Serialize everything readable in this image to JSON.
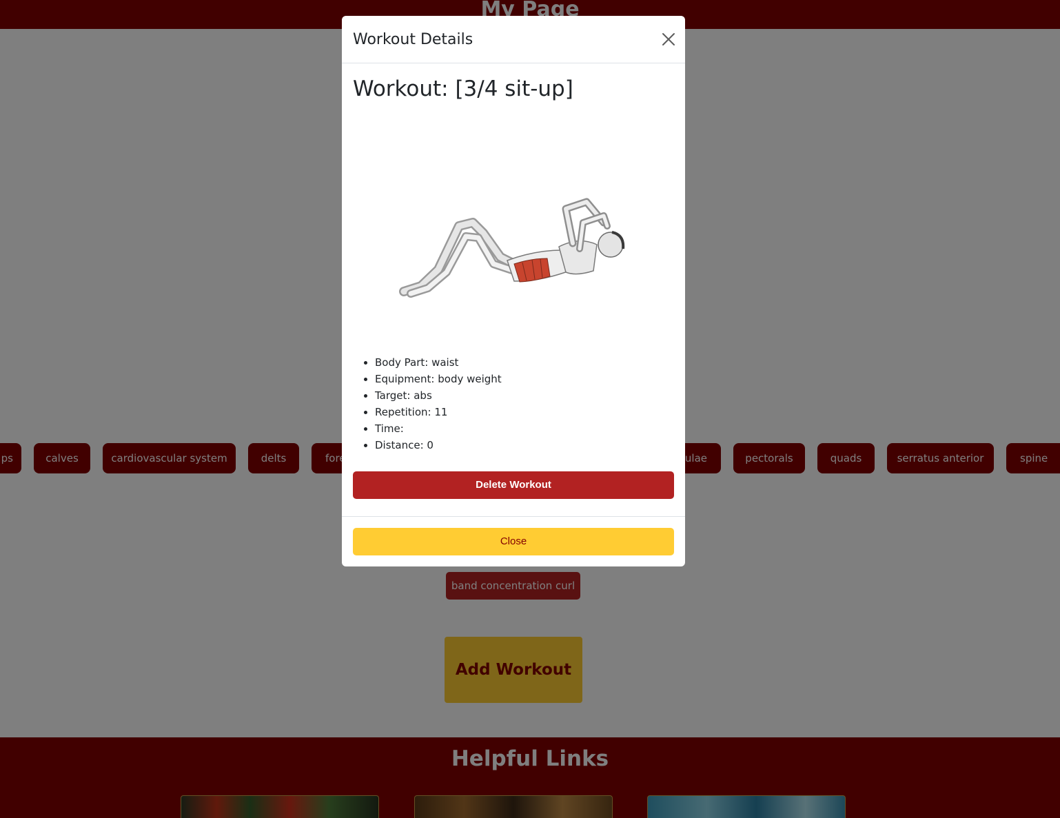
{
  "page": {
    "title": "My Page"
  },
  "muscle_chips": [
    {
      "label": "ps",
      "key": "chip-0"
    },
    {
      "label": "calves",
      "key": "chip-1"
    },
    {
      "label": "cardiovascular system",
      "key": "chip-2"
    },
    {
      "label": "delts",
      "key": "chip-3"
    },
    {
      "label": "fore",
      "key": "chip-4"
    },
    {
      "label": "pulae",
      "key": "chip-5"
    },
    {
      "label": "pectorals",
      "key": "chip-6"
    },
    {
      "label": "quads",
      "key": "chip-7"
    },
    {
      "label": "serratus anterior",
      "key": "chip-8"
    },
    {
      "label": "spine",
      "key": "chip-9"
    }
  ],
  "workouts": {
    "item_label": "band concentration curl"
  },
  "actions": {
    "add_workout_label": "Add Workout"
  },
  "helpful_links": {
    "heading": "Helpful Links"
  },
  "modal": {
    "title": "Workout Details",
    "workout_heading": "Workout: [3/4 sit-up]",
    "details": {
      "body_part": "Body Part: waist",
      "equipment": "Equipment: body weight",
      "target": "Target: abs",
      "repetition": "Repetition: 11",
      "time": "Time:",
      "distance": "Distance: 0"
    },
    "delete_label": "Delete Workout",
    "close_label": "Close",
    "close_icon": "close-icon",
    "image_icon": "exercise-illustration"
  },
  "colors": {
    "brand_dark_red": "#830000",
    "danger_red": "#b22222",
    "accent_yellow": "#ffcc33",
    "overlay": "rgba(0,0,0,0.5)"
  }
}
